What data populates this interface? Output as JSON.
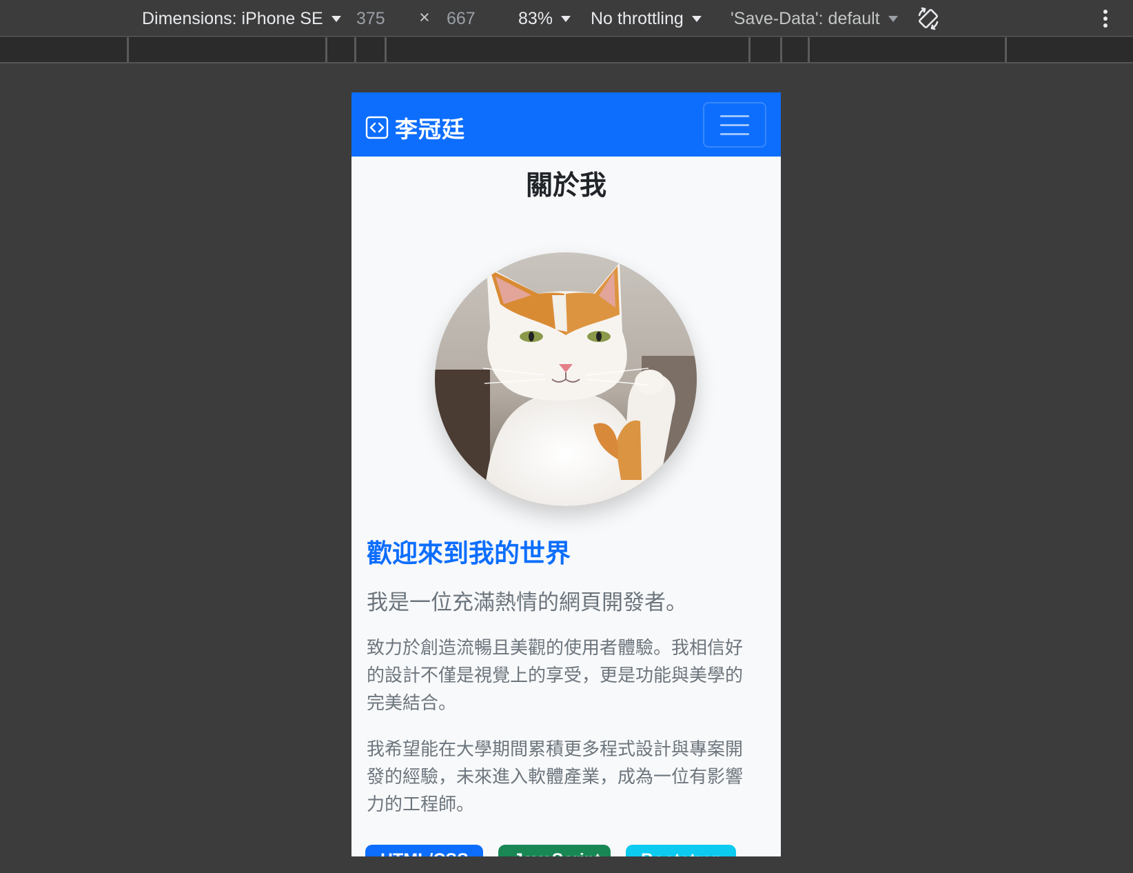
{
  "devtools": {
    "dimensions_label": "Dimensions: iPhone SE",
    "width_value": "375",
    "height_value": "667",
    "times_symbol": "×",
    "zoom": "83%",
    "throttling": "No throttling",
    "save_data": "'Save-Data': default"
  },
  "site": {
    "brand_name": "李冠廷",
    "page_title": "關於我",
    "welcome_heading": "歡迎來到我的世界",
    "lead_text": "我是一位充滿熱情的網頁開發者。",
    "paragraph_1": "致力於創造流暢且美觀的使用者體驗。我相信好的設計不僅是視覺上的享受，更是功能與美學的完美結合。",
    "paragraph_2": "我希望能在大學期間累積更多程式設計與專案開發的經驗，未來進入軟體產業，成為一位有影響力的工程師。",
    "skills": [
      "HTML/CSS",
      "JavaScript",
      "Bootstrap"
    ]
  },
  "colors": {
    "primary": "#0d6efd",
    "success": "#198754",
    "info": "#0dcaf0",
    "devtools_bg": "#3c3c3c"
  },
  "icons": {
    "brand": "code-square-icon",
    "menu": "hamburger-menu-icon",
    "rotate": "rotate-device-icon",
    "more": "more-vertical-icon"
  }
}
